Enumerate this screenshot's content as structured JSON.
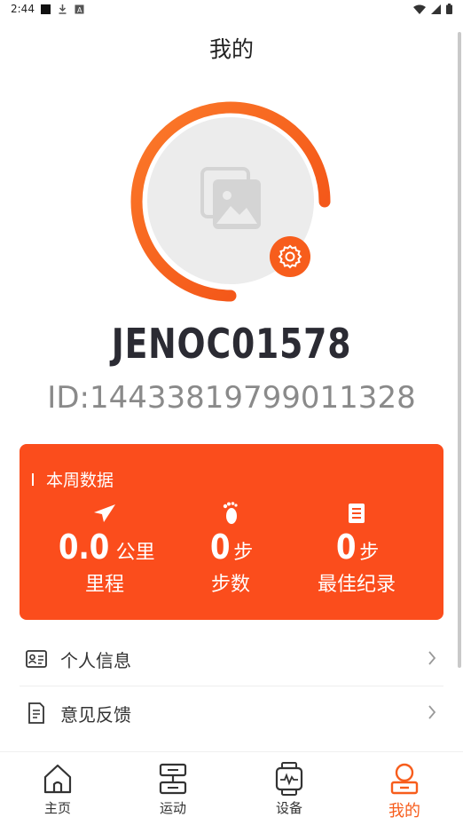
{
  "status_bar": {
    "time": "2:44"
  },
  "header": {
    "title": "我的"
  },
  "profile": {
    "username": "JENOC01578",
    "id_text": "ID:1443381979901​1328"
  },
  "stats": {
    "title": "本周数据",
    "mileage": {
      "value": "0.0",
      "unit": "公里",
      "label": "里程"
    },
    "steps": {
      "value": "0",
      "unit": "步",
      "label": "步数"
    },
    "best": {
      "value": "0",
      "unit": "步",
      "label": "最佳纪录"
    }
  },
  "menu": {
    "items": [
      {
        "label": "个人信息",
        "icon": "id-card-icon"
      },
      {
        "label": "意见反馈",
        "icon": "feedback-document-icon"
      }
    ]
  },
  "nav": {
    "items": [
      {
        "label": "主页",
        "icon": "home-icon"
      },
      {
        "label": "运动",
        "icon": "sport-icon"
      },
      {
        "label": "设备",
        "icon": "watch-icon"
      },
      {
        "label": "我的",
        "icon": "user-icon",
        "active": true
      }
    ]
  },
  "colors": {
    "accent": "#f75d1c",
    "card": "#fb4d1c"
  }
}
